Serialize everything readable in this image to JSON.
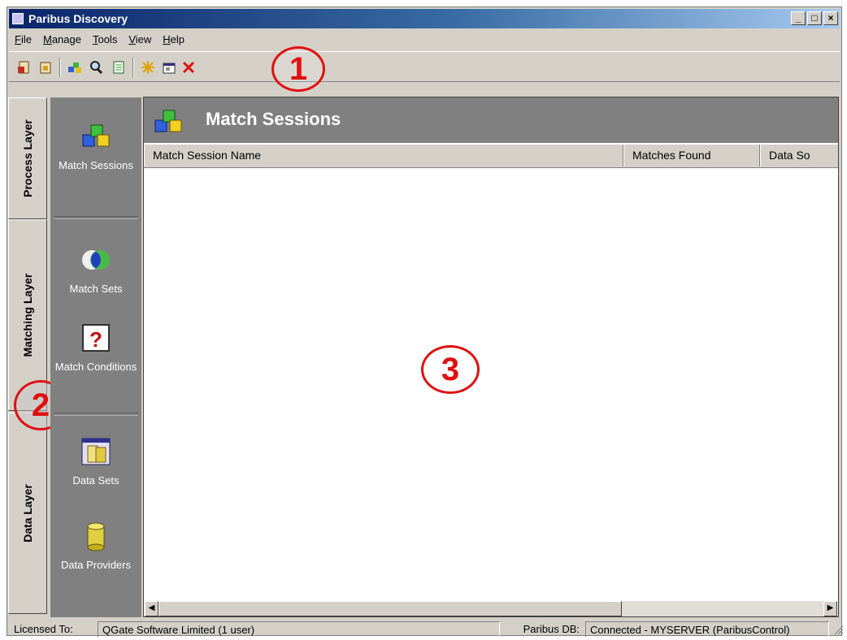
{
  "window": {
    "title": "Paribus Discovery",
    "controls": [
      "minimize-icon",
      "maximize-icon",
      "close-icon"
    ]
  },
  "menu": [
    "File",
    "Manage",
    "Tools",
    "View",
    "Help"
  ],
  "toolbar": {
    "icons": [
      "open-icon",
      "import-icon",
      "match-icon",
      "search-icon",
      "report-icon",
      "new-icon",
      "properties-icon",
      "delete-icon"
    ]
  },
  "callouts": [
    "1",
    "2",
    "3"
  ],
  "layers": [
    "Process Layer",
    "Matching Layer",
    "Data Layer"
  ],
  "shortcuts": [
    {
      "label": "Match Sessions",
      "icon": "cubes-icon"
    },
    {
      "label": "Match Sets",
      "icon": "venn-icon"
    },
    {
      "label": "Match Conditions",
      "icon": "question-icon"
    },
    {
      "label": "Data Sets",
      "icon": "datasets-icon"
    },
    {
      "label": "Data Providers",
      "icon": "database-icon"
    }
  ],
  "main": {
    "title": "Match Sessions",
    "columns": [
      "Match Session Name",
      "Matches Found",
      "Data So"
    ]
  },
  "status": {
    "licensed_label": "Licensed To:",
    "licensed_value": "QGate Software Limited (1 user)",
    "db_label": "Paribus DB:",
    "db_value": "Connected - MYSERVER (ParibusControl)"
  }
}
